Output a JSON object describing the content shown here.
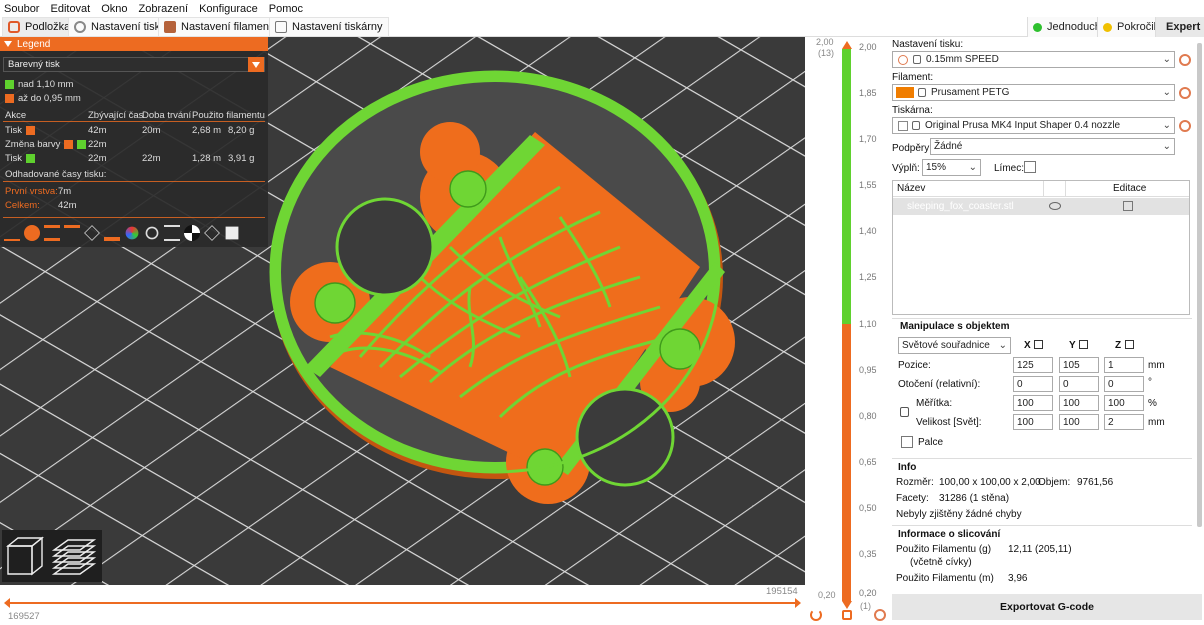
{
  "menu": [
    "Soubor",
    "Editovat",
    "Okno",
    "Zobrazení",
    "Konfigurace",
    "Pomoc"
  ],
  "tabs": [
    {
      "label": "Podložka",
      "active": true
    },
    {
      "label": "Nastavení tisku",
      "active": false
    },
    {
      "label": "Nastavení filamentu",
      "active": false
    },
    {
      "label": "Nastavení tiskárny",
      "active": false
    }
  ],
  "modes": [
    {
      "label": "Jednoduchý",
      "color": "#2ec02e"
    },
    {
      "label": "Pokročilý",
      "color": "#f0c000"
    },
    {
      "label": "Expert",
      "color": "#e00000"
    }
  ],
  "legend": {
    "title": "Legend",
    "view_type": "Barevný tisk",
    "ranges": [
      {
        "label": "nad 1,10 mm",
        "color": "#5fd12e"
      },
      {
        "label": "až do 0,95 mm",
        "color": "#ed6b21"
      }
    ],
    "headers": {
      "action": "Akce",
      "remaining": "Zbývající čas",
      "duration": "Doba trvání",
      "used": "Použito filamentu"
    },
    "rows": [
      {
        "action": "Tisk",
        "remaining": "42m",
        "duration": "20m",
        "length": "2,68 m",
        "weight": "8,20 g"
      },
      {
        "action": "Změna barvy",
        "remaining": "22m",
        "duration": "",
        "length": "",
        "weight": ""
      },
      {
        "action": "Tisk",
        "remaining": "22m",
        "duration": "22m",
        "length": "1,28 m",
        "weight": "3,91 g"
      }
    ],
    "estimated_label": "Odhadované časy tisku:",
    "first_layer_label": "První vrstva:",
    "first_layer_value": "7m",
    "total_label": "Celkem:",
    "total_value": "42m"
  },
  "hslider": {
    "left_value": "169527",
    "right_value": "195154"
  },
  "vslider": {
    "top_label": "2,00",
    "top_index": "(13)",
    "bottom_label": "0,20",
    "bottom_index": "(1)",
    "ticks": [
      "2,00",
      "1,85",
      "1,70",
      "1,55",
      "1,40",
      "1,25",
      "1,10",
      "0,95",
      "0,80",
      "0,65",
      "0,50",
      "0,35",
      "0,20"
    ]
  },
  "panel": {
    "print_settings_label": "Nastavení tisku:",
    "print_settings_value": "0.15mm SPEED",
    "filament_label": "Filament:",
    "filament_value": "Prusament PETG",
    "filament_color": "#f07d00",
    "printer_label": "Tiskárna:",
    "printer_value": "Original Prusa MK4 Input Shaper 0.4 nozzle",
    "supports_label": "Podpěry:",
    "supports_value": "Žádné",
    "infill_label": "Výplň:",
    "infill_value": "15%",
    "brim_label": "Límec:",
    "list_col_name": "Název",
    "list_col_edit": "Editace",
    "object_name": "sleeping_fox_coaster.stl",
    "manip_title": "Manipulace s objektem",
    "coord_system": "Světové souřadnice",
    "axes": [
      "X",
      "Y",
      "Z"
    ],
    "position_label": "Pozice:",
    "position": [
      "125",
      "105",
      "1"
    ],
    "rotation_label": "Otočení (relativní):",
    "rotation": [
      "0",
      "0",
      "0"
    ],
    "scale_label": "Měřítka:",
    "scale": [
      "100",
      "100",
      "100"
    ],
    "size_label": "Velikost [Svět]:",
    "size": [
      "100",
      "100",
      "2"
    ],
    "unit_mm": "mm",
    "unit_deg": "°",
    "unit_pct": "%",
    "inches_label": "Palce",
    "info_title": "Info",
    "size_info_label": "Rozměr:",
    "size_info_value": "100,00 x 100,00 x 2,00",
    "volume_label": "Objem:",
    "volume_value": "9761,56",
    "facets_label": "Facety:",
    "facets_value": "31286 (1 stěna)",
    "errors_text": "Nebyly zjištěny žádné chyby",
    "slice_title": "Informace o slicování",
    "fil_g_label": "Použito Filamentu (g)",
    "fil_g_sub": "(včetně cívky)",
    "fil_g_value": "12,11 (205,11)",
    "fil_m_label": "Použito Filamentu (m)",
    "fil_m_value": "3,96",
    "export_label": "Exportovat G-code"
  },
  "colors": {
    "accent": "#ed6b21",
    "green": "#5fd12e",
    "orange": "#ed6b21"
  }
}
